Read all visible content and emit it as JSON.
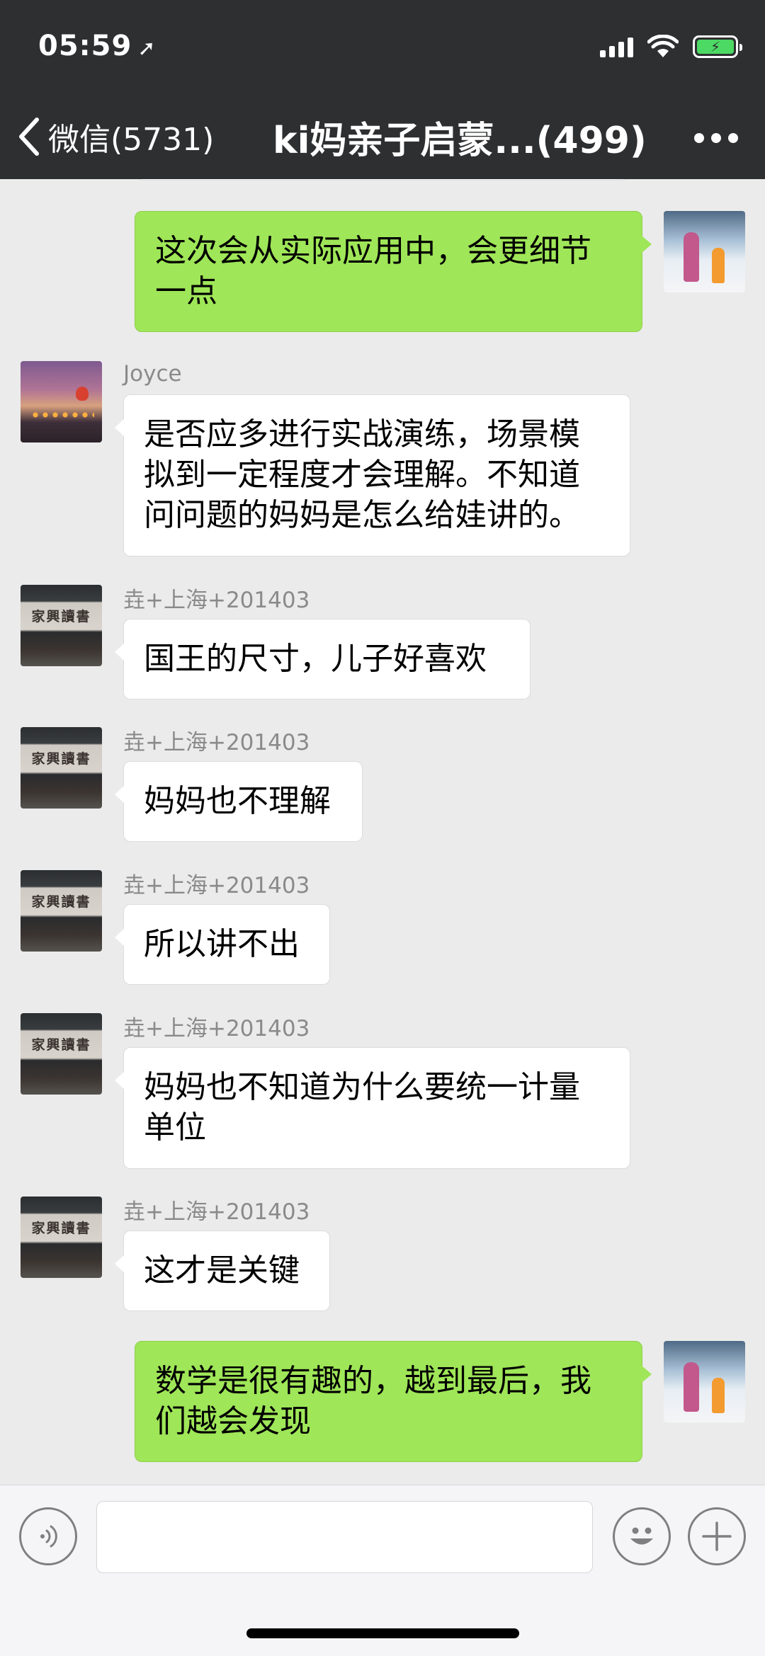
{
  "status_bar": {
    "time": "05:59",
    "location_icon": "location-arrow-icon",
    "signal_icon": "cellular-signal-icon",
    "wifi_icon": "wifi-icon",
    "battery_icon": "battery-charging-icon",
    "battery_color": "#4cd964"
  },
  "nav": {
    "back_label": "微信(5731)",
    "title": "ki妈亲子启蒙...(499)",
    "more_icon": "more-dots-icon"
  },
  "colors": {
    "header_bg": "#2e2f31",
    "chat_bg": "#ebebeb",
    "outgoing_bubble": "#9fe658",
    "incoming_bubble": "#ffffff"
  },
  "messages": [
    {
      "direction": "out",
      "text": "这次会从实际应用中，会更细节一点"
    },
    {
      "direction": "in",
      "sender": "Joyce",
      "text": "是否应多进行实战演练，场景模拟到一定程度才会理解。不知道问问题的妈妈是怎么给娃讲的。"
    },
    {
      "direction": "in",
      "sender": "垚+上海+201403",
      "text": "国王的尺寸，儿子好喜欢"
    },
    {
      "direction": "in",
      "sender": "垚+上海+201403",
      "text": "妈妈也不理解"
    },
    {
      "direction": "in",
      "sender": "垚+上海+201403",
      "text": "所以讲不出"
    },
    {
      "direction": "in",
      "sender": "垚+上海+201403",
      "text": "妈妈也不知道为什么要统一计量单位"
    },
    {
      "direction": "in",
      "sender": "垚+上海+201403",
      "text": "这才是关键"
    },
    {
      "direction": "out",
      "text": "数学是很有趣的，越到最后，我们越会发现"
    }
  ],
  "avatars": {
    "sign_text": "家興讀書"
  },
  "input_bar": {
    "voice_icon": "voice-input-icon",
    "emoji_icon": "emoji-icon",
    "plus_icon": "plus-icon",
    "input_value": ""
  }
}
